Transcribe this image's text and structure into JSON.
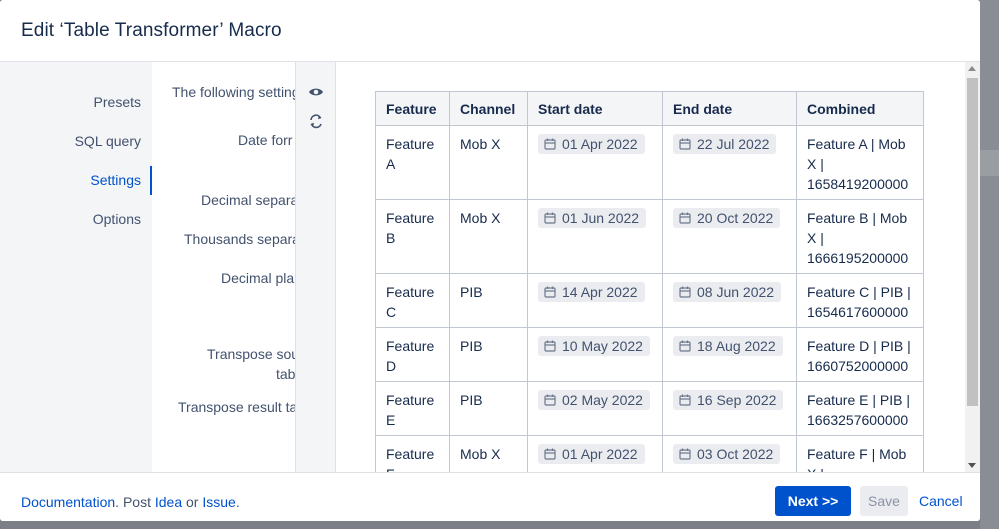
{
  "dialog": {
    "title": "Edit ‘Table Transformer’ Macro"
  },
  "nav": {
    "items": [
      {
        "label": "Presets"
      },
      {
        "label": "SQL query"
      },
      {
        "label": "Settings",
        "active": true
      },
      {
        "label": "Options"
      }
    ]
  },
  "settings": {
    "intro": "The following setting",
    "date_format": "Date forr",
    "decimal_separator": "Decimal separa",
    "thousands_separator": "Thousands separa",
    "decimal_places": "Decimal pla",
    "transpose_source_1": "Transpose sou",
    "transpose_source_2": "tab",
    "transpose_result": "Transpose result ta"
  },
  "tools": {
    "icons": [
      "eye-icon",
      "refresh-icon"
    ]
  },
  "table": {
    "headers": [
      "Feature",
      "Channel",
      "Start date",
      "End date",
      "Combined"
    ],
    "rows": [
      {
        "feature": [
          "Feature",
          "A"
        ],
        "channel": "Mob X",
        "start": "01 Apr 2022",
        "end": "22 Jul 2022",
        "combined": [
          "Feature A | Mob",
          "X |",
          "1658419200000"
        ]
      },
      {
        "feature": [
          "Feature",
          "B"
        ],
        "channel": "Mob X",
        "start": "01 Jun 2022",
        "end": "20 Oct 2022",
        "combined": [
          "Feature B | Mob",
          "X |",
          "1666195200000"
        ]
      },
      {
        "feature": [
          "Feature",
          "C"
        ],
        "channel": "PIB",
        "start": "14 Apr 2022",
        "end": "08 Jun 2022",
        "combined": [
          "Feature C | PIB |",
          "1654617600000"
        ]
      },
      {
        "feature": [
          "Feature",
          "D"
        ],
        "channel": "PIB",
        "start": "10 May 2022",
        "end": "18 Aug 2022",
        "combined": [
          "Feature D | PIB |",
          "1660752000000"
        ]
      },
      {
        "feature": [
          "Feature",
          "E"
        ],
        "channel": "PIB",
        "start": "02 May 2022",
        "end": "16 Sep 2022",
        "combined": [
          "Feature E | PIB |",
          "1663257600000"
        ]
      },
      {
        "feature": [
          "Feature",
          "F"
        ],
        "channel": "Mob X",
        "start": "01 Apr 2022",
        "end": "03 Oct 2022",
        "combined": [
          "Feature F | Mob",
          "X |"
        ]
      }
    ]
  },
  "footer": {
    "documentation": "Documentation",
    "post": ". Post",
    "idea": "Idea",
    "or": "or",
    "issue": "Issue",
    "period": ".",
    "next": "Next >>",
    "save": "Save",
    "cancel": "Cancel"
  },
  "colors": {
    "accent": "#0052cc",
    "text": "#172b4d",
    "muted": "#42526e",
    "border": "#c1c7d0"
  }
}
